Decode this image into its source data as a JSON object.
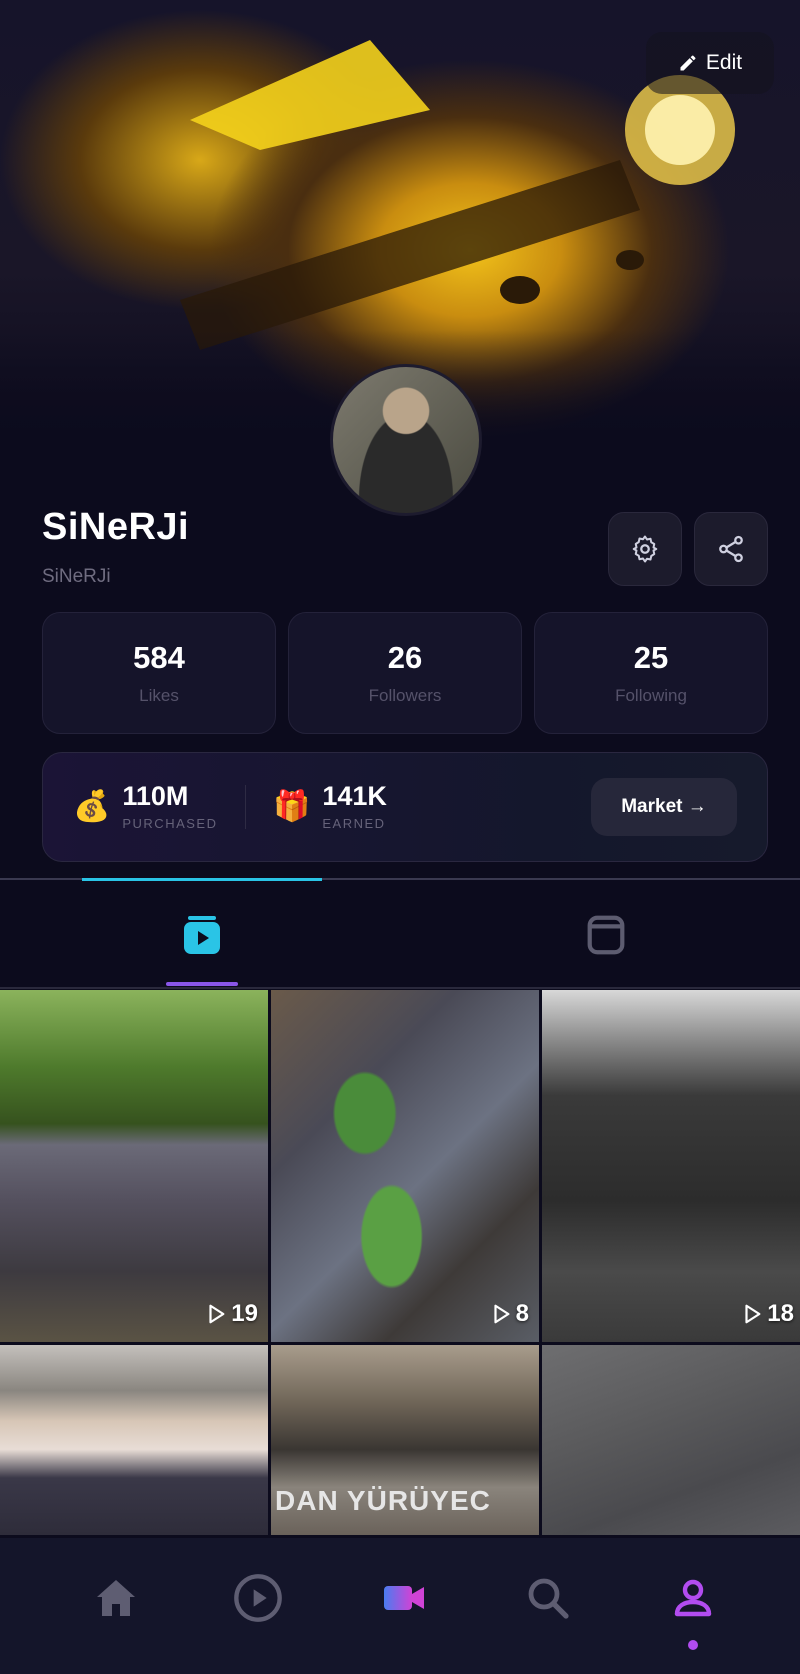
{
  "header": {
    "edit_label": "Edit"
  },
  "profile": {
    "username": "SiNeRJi",
    "handle": "SiNeRJi"
  },
  "stats": [
    {
      "value": "584",
      "label": "Likes"
    },
    {
      "value": "26",
      "label": "Followers"
    },
    {
      "value": "25",
      "label": "Following"
    }
  ],
  "wallet": {
    "purchased_value": "110M",
    "purchased_label": "PURCHASED",
    "earned_value": "141K",
    "earned_label": "EARNED",
    "market_label": "Market →"
  },
  "grid": {
    "items": [
      {
        "views": "19"
      },
      {
        "views": "8"
      },
      {
        "views": "18"
      },
      {
        "views": ""
      },
      {
        "views": "",
        "overlay_text": "DAN YÜRÜYEC"
      },
      {
        "views": ""
      }
    ]
  },
  "colors": {
    "accent_cyan": "#2ac4e6",
    "accent_purple": "#8a56e8",
    "active_nav": "#b24cf0",
    "background": "#0c0b1d"
  }
}
